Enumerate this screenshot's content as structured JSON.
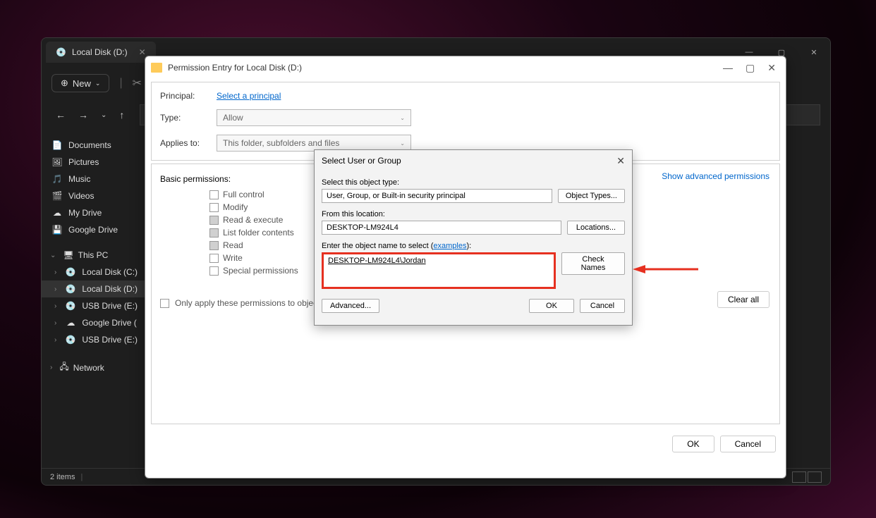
{
  "explorer": {
    "tab_title": "Local Disk (D:)",
    "new_button": "New",
    "sidebar_items": [
      {
        "icon": "📄",
        "label": "Documents"
      },
      {
        "icon": "🖼",
        "label": "Pictures"
      },
      {
        "icon": "🎵",
        "label": "Music"
      },
      {
        "icon": "🎬",
        "label": "Videos"
      },
      {
        "icon": "☁",
        "label": "My Drive"
      },
      {
        "icon": "💾",
        "label": "Google Drive"
      }
    ],
    "this_pc_label": "This PC",
    "drives": [
      {
        "icon": "💿",
        "label": "Local Disk (C:)"
      },
      {
        "icon": "💿",
        "label": "Local Disk (D:)"
      },
      {
        "icon": "💿",
        "label": "USB Drive (E:)"
      },
      {
        "icon": "☁",
        "label": "Google Drive ("
      },
      {
        "icon": "💿",
        "label": "USB Drive (E:)"
      }
    ],
    "network_label": "Network",
    "statusbar": "2 items"
  },
  "perm": {
    "title": "Permission Entry for Local Disk (D:)",
    "principal_label": "Principal:",
    "principal_link": "Select a principal",
    "type_label": "Type:",
    "type_value": "Allow",
    "applies_label": "Applies to:",
    "applies_value": "This folder, subfolders and files",
    "basic_label": "Basic permissions:",
    "show_advanced": "Show advanced permissions",
    "perms": [
      {
        "label": "Full control",
        "checked": false
      },
      {
        "label": "Modify",
        "checked": false
      },
      {
        "label": "Read & execute",
        "checked": true
      },
      {
        "label": "List folder contents",
        "checked": true
      },
      {
        "label": "Read",
        "checked": true
      },
      {
        "label": "Write",
        "checked": false
      },
      {
        "label": "Special permissions",
        "checked": false
      }
    ],
    "only_apply": "Only apply these permissions to objects and/or containers within this container",
    "clear_all": "Clear all",
    "ok": "OK",
    "cancel": "Cancel"
  },
  "select": {
    "title": "Select User or Group",
    "object_type_label": "Select this object type:",
    "object_type_value": "User, Group, or Built-in security principal",
    "object_types_btn": "Object Types...",
    "location_label": "From this location:",
    "location_value": "DESKTOP-LM924L4",
    "locations_btn": "Locations...",
    "name_label_prefix": "Enter the object name to select (",
    "examples": "examples",
    "name_label_suffix": "):",
    "name_value": "DESKTOP-LM924L4\\Jordan",
    "check_names": "Check Names",
    "advanced": "Advanced...",
    "ok": "OK",
    "cancel": "Cancel"
  }
}
